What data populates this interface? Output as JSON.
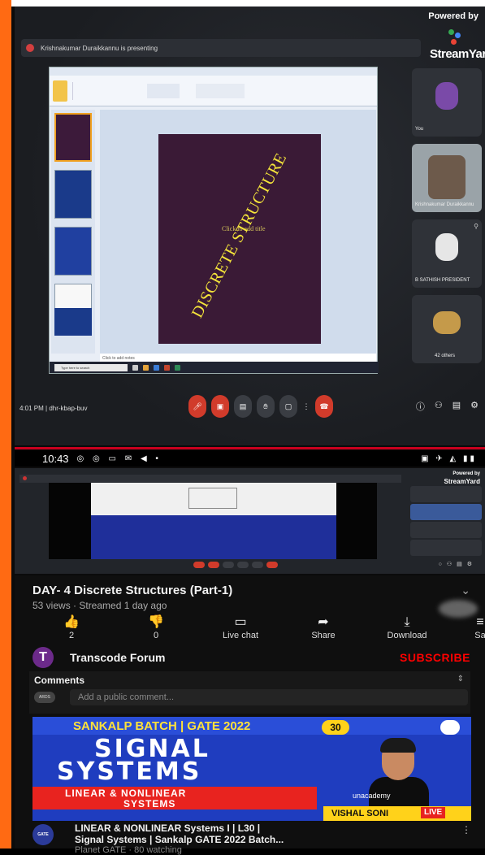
{
  "meeting": {
    "powered_by": "Powered by",
    "logo_text": "StreamYard",
    "presenting_banner": "Krishnakumar Duraikkannu is presenting",
    "slide_title": "DISCRETE STRUCTURE",
    "slide_subtitle": "Click to add title",
    "notes_placeholder": "Click to add notes",
    "taskbar_search": "Type here to search",
    "participants": [
      {
        "label": "You"
      },
      {
        "label": "Krishnakumar Duraikkannu"
      },
      {
        "label": "B SATHISH PRESIDENT"
      },
      {
        "label": "42 others"
      }
    ],
    "bottom_info": "4:01 PM  |  dhr-kbap-buv",
    "accent_red": "#d13b2b"
  },
  "status_bar": {
    "time": "10:43",
    "left_icons": "◎ ◎ ▭ ✉ ◀ •",
    "right_icons": "▣ ✈ ◭ ▮▮"
  },
  "mini_player": {
    "powered_by": "Powered by",
    "logo_text": "StreamYard"
  },
  "video": {
    "title": "DAY- 4 Discrete Structures (Part-1)",
    "meta": "53 views · Streamed 1 day ago",
    "actions": [
      {
        "icon": "thumbs-up",
        "glyph": "👍",
        "label": "2"
      },
      {
        "icon": "thumbs-down",
        "glyph": "👎",
        "label": "0"
      },
      {
        "icon": "live-chat",
        "glyph": "▭",
        "label": "Live chat"
      },
      {
        "icon": "share",
        "glyph": "➦",
        "label": "Share"
      },
      {
        "icon": "download",
        "glyph": "⤓",
        "label": "Download"
      },
      {
        "icon": "save",
        "glyph": "≡",
        "label": "Sa"
      }
    ]
  },
  "channel": {
    "avatar_letter": "T",
    "name": "Transcode Forum",
    "subscribe_label": "SUBSCRIBE",
    "subscribe_color": "#ff0000"
  },
  "comments": {
    "title": "Comments",
    "avatar_text": "ARDS",
    "placeholder": "Add a public comment..."
  },
  "recommendation": {
    "thumb": {
      "batch": "SANKALP BATCH | GATE 2022",
      "badge": "30",
      "line1": "SIGNAL",
      "line2": "SYSTEMS",
      "red1": "LINEAR & NONLINEAR",
      "red2": "SYSTEMS",
      "brand": "unacademy",
      "presenter": "VISHAL SONI",
      "live": "LIVE"
    },
    "channel_avatar": "GATE",
    "title_line1": "LINEAR & NONLINEAR Systems I | L30 |",
    "title_line2": "Signal Systems | Sankalp GATE 2022 Batch...",
    "meta": "Planet GATE · 80 watching"
  }
}
